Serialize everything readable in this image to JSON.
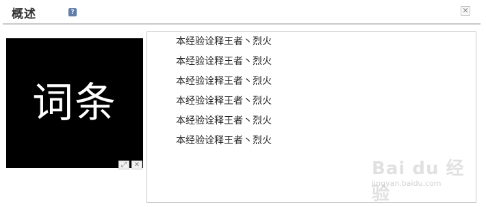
{
  "header": {
    "title": "概述",
    "help_icon": "question-icon",
    "help_glyph": "?",
    "close_glyph": "✕"
  },
  "image": {
    "text": "词条",
    "expand_glyph": "⤢",
    "close_glyph": "✕"
  },
  "list": {
    "items": [
      "本经验诠释王者丶烈火",
      "本经验诠释王者丶烈火",
      "本经验诠释王者丶烈火",
      "本经验诠释王者丶烈火",
      "本经验诠释王者丶烈火",
      "本经验诠释王者丶烈火"
    ]
  },
  "watermark": {
    "brand": "Bai du 经验",
    "url": "jingyan.baidu.com"
  },
  "colors": {
    "help_icon_bg": "#5f7fa8",
    "divider": "#c9c9c9",
    "image_bg": "#000000"
  }
}
